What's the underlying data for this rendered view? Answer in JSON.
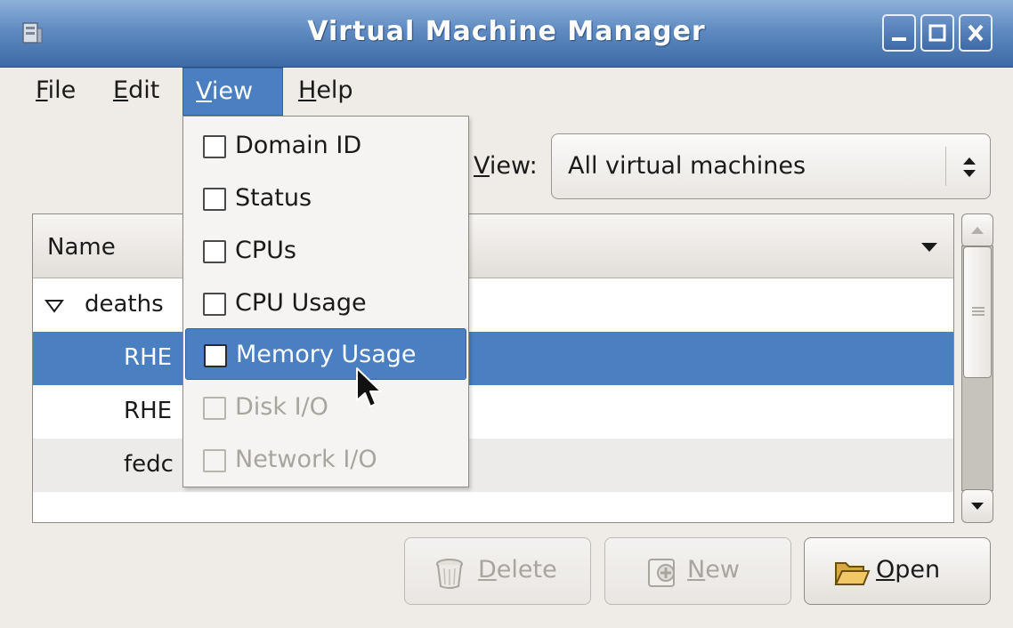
{
  "window": {
    "title": "Virtual Machine Manager",
    "icons": {
      "app": "vm-manager-icon",
      "minimize": "minimize-icon",
      "maximize": "maximize-icon",
      "close": "close-icon"
    }
  },
  "menubar": {
    "items": [
      {
        "mnemonic": "F",
        "rest": "ile"
      },
      {
        "mnemonic": "E",
        "rest": "dit"
      },
      {
        "mnemonic": "V",
        "rest": "iew",
        "open": true
      },
      {
        "mnemonic": "H",
        "rest": "elp"
      }
    ]
  },
  "view_filter": {
    "label_mnemonic": "V",
    "label_rest": "iew:",
    "selected": "All virtual machines",
    "icon": "up-down-arrows-icon"
  },
  "vm_list": {
    "header": {
      "name": "Name",
      "sort_icon": "sort-down-icon"
    },
    "rows": [
      {
        "label": "deaths",
        "type": "host",
        "expanded": true
      },
      {
        "label": "RHE",
        "selected": true
      },
      {
        "label": "RHE"
      },
      {
        "label": "fedc"
      }
    ]
  },
  "buttons": {
    "delete": {
      "mnemonic": "D",
      "rest": "elete",
      "enabled": false,
      "icon": "trash-icon"
    },
    "new": {
      "mnemonic": "N",
      "rest": "ew",
      "enabled": false,
      "icon": "new-vm-icon"
    },
    "open": {
      "mnemonic": "O",
      "rest": "pen",
      "enabled": true,
      "icon": "folder-open-icon"
    }
  },
  "view_menu": {
    "items": [
      {
        "label": "Domain ID",
        "enabled": true,
        "checked": false
      },
      {
        "label": "Status",
        "enabled": true,
        "checked": false
      },
      {
        "label": "CPUs",
        "enabled": true,
        "checked": false
      },
      {
        "label": "CPU Usage",
        "enabled": true,
        "checked": false
      },
      {
        "label": "Memory Usage",
        "enabled": true,
        "checked": false,
        "hovered": true
      },
      {
        "label": "Disk I/O",
        "enabled": false,
        "checked": false
      },
      {
        "label": "Network I/O",
        "enabled": false,
        "checked": false
      }
    ]
  },
  "colors": {
    "selection": "#4a7fc1",
    "titlebar": "#5f8bc2",
    "window_bg": "#efebe7"
  }
}
